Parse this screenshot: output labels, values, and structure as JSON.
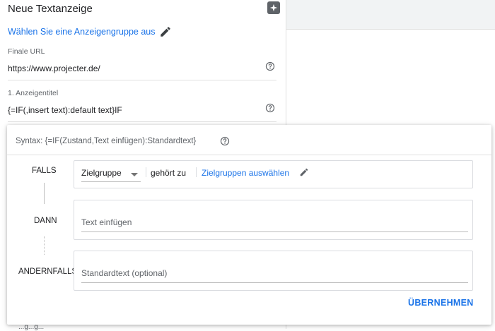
{
  "editor": {
    "title": "Neue Textanzeige",
    "adgroup_link": "Wählen Sie eine Anzeigengruppe aus",
    "final_url": {
      "label": "Finale URL",
      "value": "https://www.projecter.de/"
    },
    "headline1": {
      "label": "1. Anzeigentitel",
      "value": "{=IF(,insert text):default text}IF"
    },
    "bottom_partial": "...g...g..."
  },
  "dialog": {
    "syntax": "Syntax: {=IF(Zustand,Text einfügen):Standardtext}",
    "rows": {
      "falls": "FALLS",
      "dann": "DANN",
      "andernfalls": "ANDERNFALLS"
    },
    "condition": {
      "type_value": "Zielgruppe",
      "operator": "gehört zu",
      "choose_link": "Zielgruppen auswählen"
    },
    "then_placeholder": "Text einfügen",
    "else_placeholder": "Standardtext (optional)",
    "apply_button": "ÜBERNEHMEN"
  },
  "colors": {
    "link": "#1a73e8",
    "text": "#202124",
    "muted": "#5f6368",
    "divider": "#e0e0e0"
  },
  "icons": {
    "sparkle": "sparkle-icon",
    "pencil": "pencil-icon",
    "help": "help-circle-icon",
    "dropdown": "dropdown-arrow-icon"
  }
}
